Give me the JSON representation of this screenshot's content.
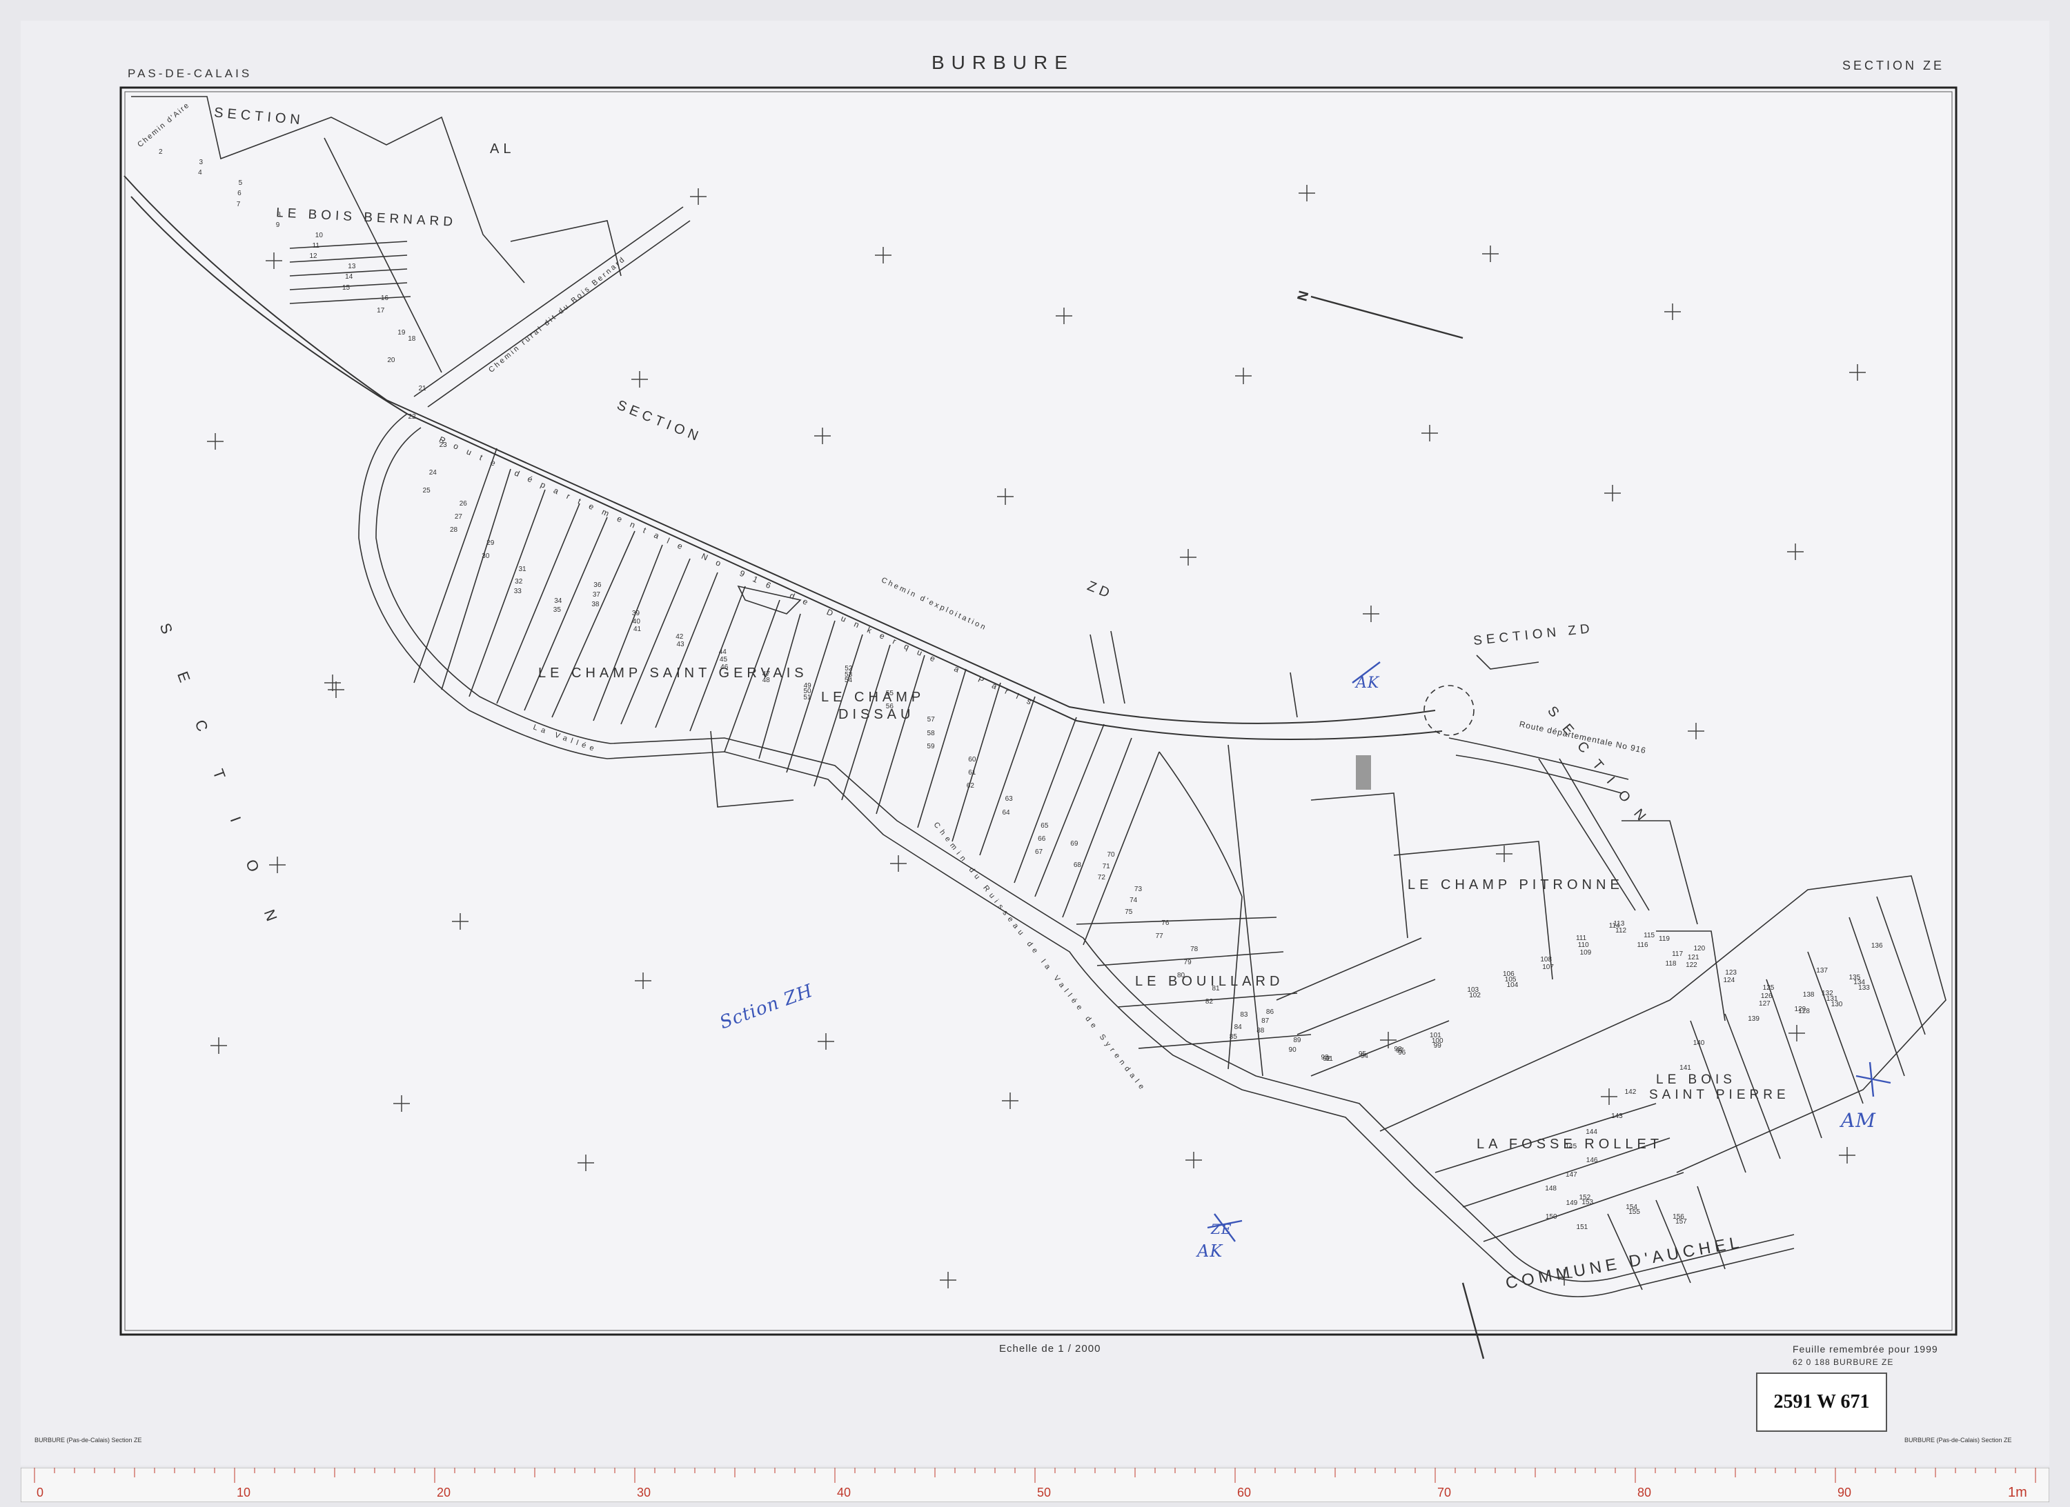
{
  "header": {
    "department": "PAS-DE-CALAIS",
    "commune": "BURBURE",
    "section": "SECTION ZE"
  },
  "footer": {
    "scale": "Echelle de 1 / 2000",
    "renewal": "Feuille remembrée pour 1999",
    "reference": "62 0 188   BURBURE  ZE",
    "archive_stamp": "2591 W 671",
    "margin_left": "BURBURE (Pas-de-Calais) Section ZE",
    "margin_right": "BURBURE (Pas-de-Calais) Section ZE"
  },
  "places": {
    "bois_bernard": "LE BOIS BERNARD",
    "champ_saint_gervais": "LE CHAMP SAINT GERVAIS",
    "champ_dissau_1": "LE CHAMP",
    "champ_dissau_2": "DISSAU",
    "bouillard": "LE BOUILLARD",
    "champ_pitronne": "LE CHAMP PITRONNE",
    "bois_saint_pierre_1": "LE BOIS",
    "bois_saint_pierre_2": "SAINT PIERRE",
    "fosse_rollet": "LA FOSSE ROLLET",
    "commune_auchel": "COMMUNE D'AUCHEL"
  },
  "sections": {
    "al_1": "SECTION",
    "al_2": "AL",
    "zd_1": "SECTION",
    "zd_2": "ZD",
    "zd_right": "SECTION ZD",
    "zh_vertical": "SECTION",
    "zh_right_diag": "SECTION"
  },
  "roads": {
    "road_1": "Route départementale No 916 de Dunkerque à Paris",
    "road_2": "Route départementale No 916",
    "chemin_1": "Chemin d'exploitation",
    "chemin_2": "Chemin du Ruisseau de la Vallée de Syrendale",
    "chemin_3": "Chemin rural dit du Bois Bernard",
    "chemin_4": "La Vallée",
    "chemin_5": "Chemin d'Aire"
  },
  "annotations": {
    "handwritten_zh": "Sction ZH",
    "handwritten_am": "AM",
    "handwritten_ak_1": "AK",
    "handwritten_ak_2": "AK",
    "handwritten_ze": "ZE",
    "north": "N"
  },
  "parcels": [
    "2",
    "3",
    "4",
    "5",
    "6",
    "7",
    "8",
    "9",
    "10",
    "11",
    "12",
    "13",
    "14",
    "15",
    "16",
    "17",
    "18",
    "19",
    "20",
    "21",
    "22",
    "23",
    "24",
    "25",
    "26",
    "27",
    "28",
    "29",
    "30",
    "31",
    "32",
    "33",
    "34",
    "35",
    "36",
    "37",
    "38",
    "39",
    "40",
    "41",
    "42",
    "43",
    "44",
    "45",
    "46",
    "47",
    "48",
    "49",
    "50",
    "51",
    "52",
    "53",
    "54",
    "55",
    "56",
    "57",
    "58",
    "59",
    "60",
    "61",
    "62",
    "63",
    "64",
    "65",
    "66",
    "67",
    "68",
    "69",
    "70",
    "71",
    "72",
    "73",
    "74",
    "75",
    "76",
    "77",
    "78",
    "79",
    "80",
    "81",
    "82",
    "83",
    "84",
    "85",
    "86",
    "87",
    "88",
    "89",
    "90",
    "91",
    "92",
    "93",
    "94",
    "95",
    "96",
    "97",
    "98",
    "99",
    "100",
    "101",
    "102",
    "103",
    "104",
    "105",
    "106",
    "107",
    "108",
    "109",
    "110",
    "111",
    "112",
    "113",
    "114",
    "115",
    "116",
    "117",
    "118",
    "119",
    "120",
    "121",
    "122",
    "123",
    "124",
    "125",
    "126",
    "127",
    "128",
    "129",
    "130",
    "131",
    "132",
    "133",
    "134",
    "135",
    "136",
    "137",
    "138",
    "139",
    "140",
    "141",
    "142",
    "143",
    "144",
    "145",
    "146",
    "147",
    "148",
    "149",
    "150",
    "151",
    "152",
    "153",
    "154",
    "155",
    "156",
    "157"
  ],
  "ruler": {
    "major": [
      "0",
      "10",
      "20",
      "30",
      "40",
      "50",
      "60",
      "70",
      "80",
      "90"
    ],
    "end": "1m"
  },
  "colors": {
    "paper": "#eeeef2",
    "ink": "#222222",
    "blue_ink": "#3a55b8",
    "ruler_red": "#c0392b"
  }
}
